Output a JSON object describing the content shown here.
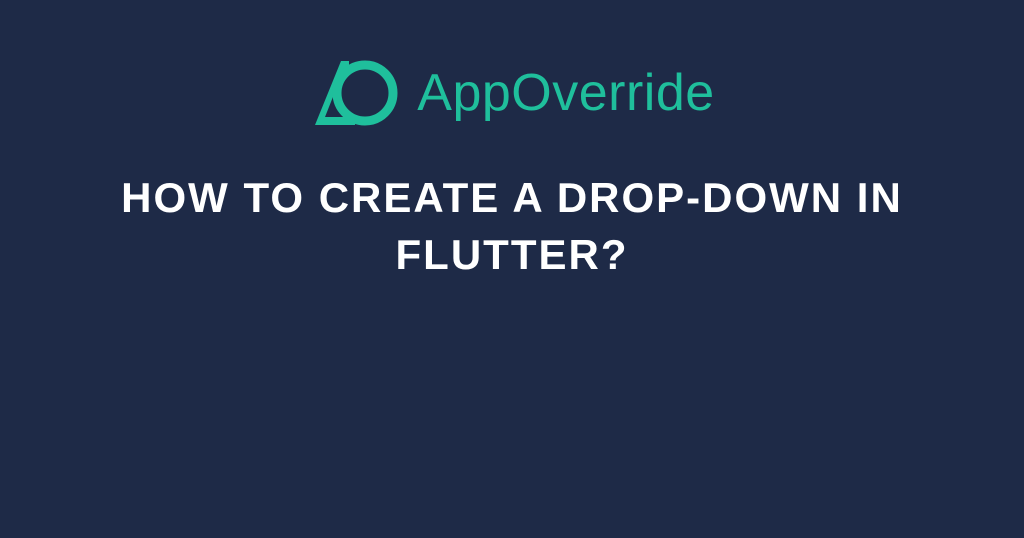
{
  "brand": {
    "name": "AppOverride",
    "accent_color": "#1fbf9c"
  },
  "headline": "HOW TO CREATE A DROP-DOWN IN FLUTTER?",
  "background_color": "#1e2a47"
}
